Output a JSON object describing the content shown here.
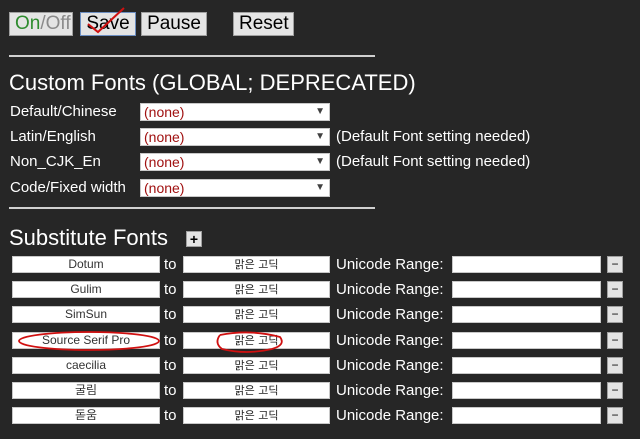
{
  "toolbar": {
    "on_label": "On",
    "slash": "/",
    "off_label": "Off",
    "save_label": "Save",
    "pause_label": "Pause",
    "reset_label": "Reset"
  },
  "custom_fonts": {
    "title": "Custom Fonts (GLOBAL; DEPRECATED)",
    "rows": [
      {
        "label": "Default/Chinese",
        "value": "(none)",
        "note": ""
      },
      {
        "label": "Latin/English",
        "value": "(none)",
        "note": "(Default Font setting needed)"
      },
      {
        "label": "Non_CJK_En",
        "value": "(none)",
        "note": "(Default Font setting needed)"
      },
      {
        "label": "Code/Fixed width",
        "value": "(none)",
        "note": ""
      }
    ]
  },
  "substitute_fonts": {
    "title": "Substitute Fonts",
    "add_label": "+",
    "to_label": "to",
    "unicode_label": "Unicode Range:",
    "remove_label": "−",
    "rows": [
      {
        "from": "Dotum",
        "to": "맑은 고딕",
        "range": ""
      },
      {
        "from": "Gulim",
        "to": "맑은 고딕",
        "range": ""
      },
      {
        "from": "SimSun",
        "to": "맑은 고딕",
        "range": ""
      },
      {
        "from": "Source Serif Pro",
        "to": "맑은 고딕",
        "range": ""
      },
      {
        "from": "caecilia",
        "to": "맑은 고딕",
        "range": ""
      },
      {
        "from": "굴림",
        "to": "맑은 고딕",
        "range": ""
      },
      {
        "from": "돋움",
        "to": "맑은 고딕",
        "range": ""
      }
    ]
  },
  "colors": {
    "background": "#262626",
    "on_green": "#2e8b2e",
    "annotation_red": "#d01010"
  }
}
